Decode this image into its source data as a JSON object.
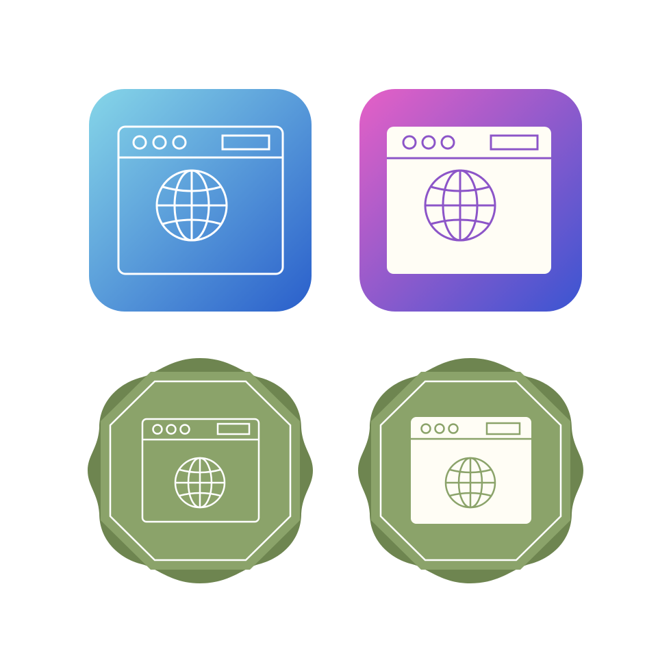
{
  "icons": [
    {
      "id": "browser-globe-outline-blue",
      "style": "outline",
      "background": "rounded-square-gradient",
      "gradient": [
        "#7fd3e6",
        "#2f63cc"
      ],
      "stroke": "#ffffff"
    },
    {
      "id": "browser-globe-filled-purple",
      "style": "filled",
      "background": "rounded-square-gradient",
      "gradient": [
        "#e063c8",
        "#3f56d2"
      ],
      "fill": "#fffdf5",
      "stroke": "#8a55c9"
    },
    {
      "id": "browser-globe-outline-green",
      "style": "outline",
      "background": "badge",
      "badge_dark": "#6d8450",
      "badge_light": "#8ba36a",
      "stroke": "#ffffff"
    },
    {
      "id": "browser-globe-filled-green",
      "style": "filled",
      "background": "badge",
      "badge_dark": "#6d8450",
      "badge_light": "#8ba36a",
      "fill": "#fffdf5",
      "stroke": "#8ba36a"
    }
  ]
}
